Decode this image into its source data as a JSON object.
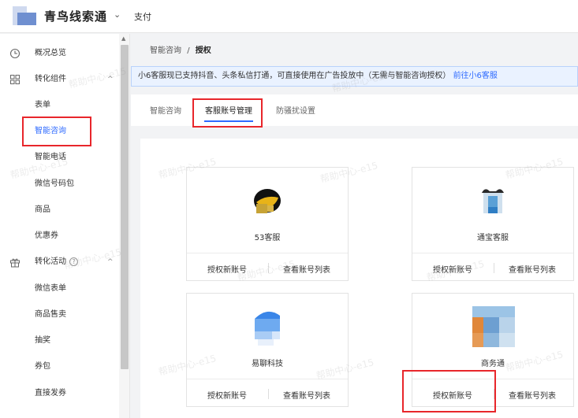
{
  "header": {
    "brand": "青鸟线索通",
    "chevron": "⌄",
    "sub_title": "支付"
  },
  "sidebar": {
    "items": [
      {
        "label": "概况总览",
        "icon": "clock-icon"
      },
      {
        "label": "转化组件",
        "icon": "grid-icon",
        "caret": "^"
      },
      {
        "label": "表单"
      },
      {
        "label": "智能咨询"
      },
      {
        "label": "智能电话"
      },
      {
        "label": "微信号码包"
      },
      {
        "label": "商品"
      },
      {
        "label": "优惠券"
      },
      {
        "label": "转化活动",
        "icon": "gift-icon",
        "help": "?",
        "caret": "^"
      },
      {
        "label": "微信表单"
      },
      {
        "label": "商品售卖"
      },
      {
        "label": "抽奖"
      },
      {
        "label": "券包"
      },
      {
        "label": "直接发券"
      }
    ]
  },
  "breadcrumb": {
    "parent": "智能咨询",
    "separator": "/",
    "current": "授权"
  },
  "notice": {
    "text": "小6客服现已支持抖音、头条私信打通，可直接使用在广告投放中（无需与智能咨询授权）",
    "link": "前往小6客服"
  },
  "tabs": [
    {
      "label": "智能咨询"
    },
    {
      "label": "客服账号管理",
      "active": true
    },
    {
      "label": "防骚扰设置"
    }
  ],
  "cards": [
    {
      "name": "53客服",
      "authorize": "授权新账号",
      "list": "查看账号列表"
    },
    {
      "name": "通宝客服",
      "authorize": "授权新账号",
      "list": "查看账号列表"
    },
    {
      "name": "易聊科技",
      "authorize": "授权新账号",
      "list": "查看账号列表"
    },
    {
      "name": "商务通",
      "authorize": "授权新账号",
      "list": "查看账号列表"
    }
  ],
  "watermark": "帮助中心-e15",
  "colors": {
    "accent": "#2f6bff",
    "highlight_box": "#e8262b",
    "notice_bg": "#eaf2ff"
  }
}
